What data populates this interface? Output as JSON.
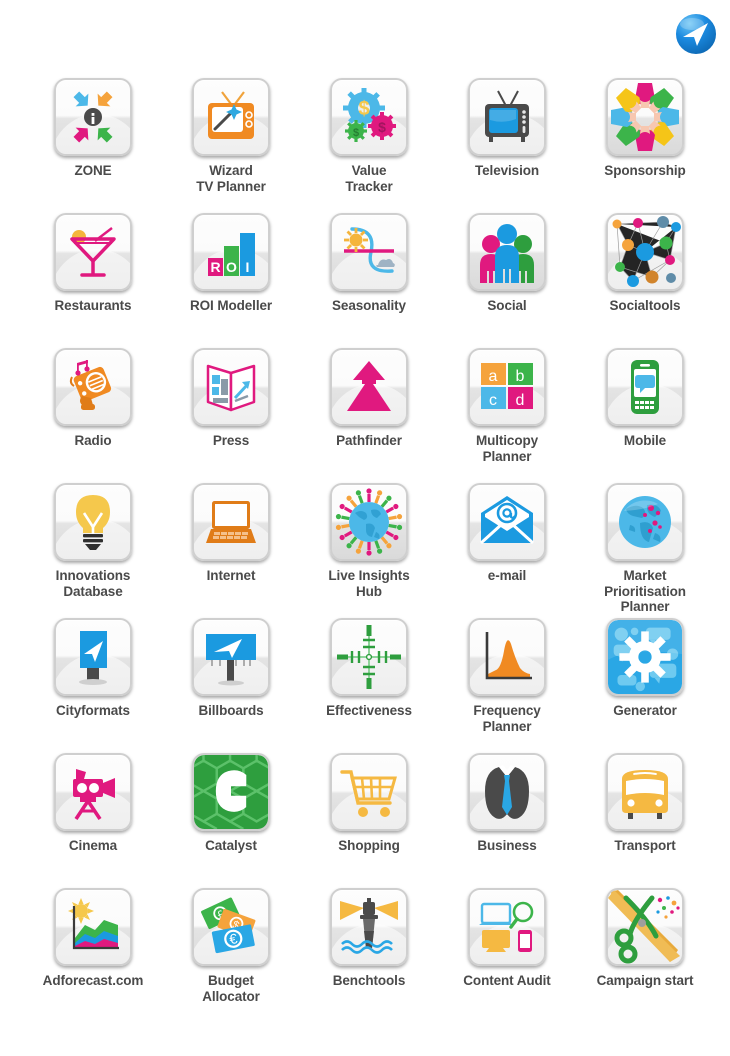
{
  "logo": {
    "name": "company-logo",
    "color": "#1b8ae0"
  },
  "grid": {
    "columns": 5,
    "items": [
      {
        "label": "ZONE",
        "icon": "zone-arrows-icon",
        "colors": [
          "#4cb8e8",
          "#f5a33c",
          "#e0197f",
          "#3cb44a"
        ]
      },
      {
        "label": "Wizard\nTV Planner",
        "icon": "wizard-tv-icon",
        "colors": [
          "#f08a22",
          "#4cb8e8"
        ]
      },
      {
        "label": "Value\nTracker",
        "icon": "value-gears-icon",
        "colors": [
          "#4cb8e8",
          "#e0197f",
          "#3cb44a"
        ]
      },
      {
        "label": "Television",
        "icon": "television-icon",
        "colors": [
          "#3a3a3a",
          "#1b9ae0"
        ]
      },
      {
        "label": "Sponsorship",
        "icon": "sponsorship-hands-icon",
        "colors": [
          "#e0197f",
          "#3cb44a",
          "#f5c518",
          "#4cb8e8"
        ]
      },
      {
        "label": "Restaurants",
        "icon": "cocktail-glass-icon",
        "colors": [
          "#e0197f",
          "#f5a33c"
        ]
      },
      {
        "label": "ROI Modeller",
        "icon": "roi-bars-icon",
        "colors": [
          "#e0197f",
          "#3cb44a",
          "#1b9ae0"
        ]
      },
      {
        "label": "Seasonality",
        "icon": "seasonality-curve-icon",
        "colors": [
          "#4cb8e8",
          "#e0197f",
          "#f5c518"
        ]
      },
      {
        "label": "Social",
        "icon": "social-people-icon",
        "colors": [
          "#e0197f",
          "#1b9ae0",
          "#2e9e3e"
        ]
      },
      {
        "label": "Socialtools",
        "icon": "network-graph-icon",
        "colors": [
          "#1b9ae0",
          "#e0197f",
          "#3cb44a",
          "#f5a33c"
        ]
      },
      {
        "label": "Radio",
        "icon": "radio-icon",
        "colors": [
          "#f08a22",
          "#e0197f"
        ]
      },
      {
        "label": "Press",
        "icon": "press-newspaper-icon",
        "colors": [
          "#e0197f",
          "#4cb8e8",
          "#8a9aa8"
        ]
      },
      {
        "label": "Pathfinder",
        "icon": "pathfinder-arrow-icon",
        "colors": [
          "#e0197f"
        ]
      },
      {
        "label": "Multicopy\nPlanner",
        "icon": "multicopy-quadrants-icon",
        "colors": [
          "#f5a33c",
          "#3cb44a",
          "#4cb8e8",
          "#e0197f"
        ]
      },
      {
        "label": "Mobile",
        "icon": "mobile-phone-icon",
        "colors": [
          "#2e9e3e",
          "#4cb8e8"
        ]
      },
      {
        "label": "Innovations\nDatabase",
        "icon": "lightbulb-icon",
        "colors": [
          "#f5c84c",
          "#3a3a3a"
        ]
      },
      {
        "label": "Internet",
        "icon": "laptop-icon",
        "colors": [
          "#e07c18"
        ]
      },
      {
        "label": "Live Insights\nHub",
        "icon": "live-insights-globe-icon",
        "colors": [
          "#4cb8e8",
          "#e0197f",
          "#3cb44a",
          "#f5a33c"
        ]
      },
      {
        "label": "e-mail",
        "icon": "email-envelope-icon",
        "colors": [
          "#1b9ae0"
        ]
      },
      {
        "label": "Market\nPrioritisation\nPlanner",
        "icon": "world-globe-icon",
        "colors": [
          "#4cb8e8",
          "#e0197f"
        ]
      },
      {
        "label": "Cityformats",
        "icon": "cityformat-panel-icon",
        "colors": [
          "#1b9ae0",
          "#3a3a3a"
        ]
      },
      {
        "label": "Billboards",
        "icon": "billboard-icon",
        "colors": [
          "#1b9ae0",
          "#3a3a3a"
        ]
      },
      {
        "label": "Effectiveness",
        "icon": "crosshair-target-icon",
        "colors": [
          "#2e9e3e"
        ]
      },
      {
        "label": "Frequency\nPlanner",
        "icon": "frequency-chart-icon",
        "colors": [
          "#f08a22",
          "#3a3a3a"
        ]
      },
      {
        "label": "Generator",
        "icon": "generator-gear-icon",
        "colors": [
          "#1b9ae0",
          "#ffffff"
        ]
      },
      {
        "label": "Cinema",
        "icon": "movie-camera-icon",
        "colors": [
          "#e0197f"
        ]
      },
      {
        "label": "Catalyst",
        "icon": "catalyst-c-icon",
        "colors": [
          "#2e9e3e"
        ]
      },
      {
        "label": "Shopping",
        "icon": "shopping-cart-icon",
        "colors": [
          "#f5b942"
        ]
      },
      {
        "label": "Business",
        "icon": "business-suit-icon",
        "colors": [
          "#3a3a3a",
          "#1b9ae0"
        ]
      },
      {
        "label": "Transport",
        "icon": "bus-icon",
        "colors": [
          "#f5b942"
        ]
      },
      {
        "label": "Adforecast.com",
        "icon": "adforecast-chart-icon",
        "colors": [
          "#f5c84c",
          "#3cb44a",
          "#1b9ae0",
          "#e0197f"
        ]
      },
      {
        "label": "Budget\nAllocator",
        "icon": "budget-banknotes-icon",
        "colors": [
          "#3cb44a",
          "#f5a33c",
          "#1b9ae0"
        ]
      },
      {
        "label": "Benchtools",
        "icon": "lighthouse-icon",
        "colors": [
          "#f5b942",
          "#4a4a4a",
          "#1b9ae0"
        ]
      },
      {
        "label": "Content Audit",
        "icon": "content-audit-icon",
        "colors": [
          "#4cb8e8",
          "#3cb44a",
          "#f5b942",
          "#e0197f"
        ]
      },
      {
        "label": "Campaign start",
        "icon": "scissors-ribbon-icon",
        "colors": [
          "#2e9e3e",
          "#f0b53c",
          "#e0197f"
        ]
      }
    ]
  }
}
